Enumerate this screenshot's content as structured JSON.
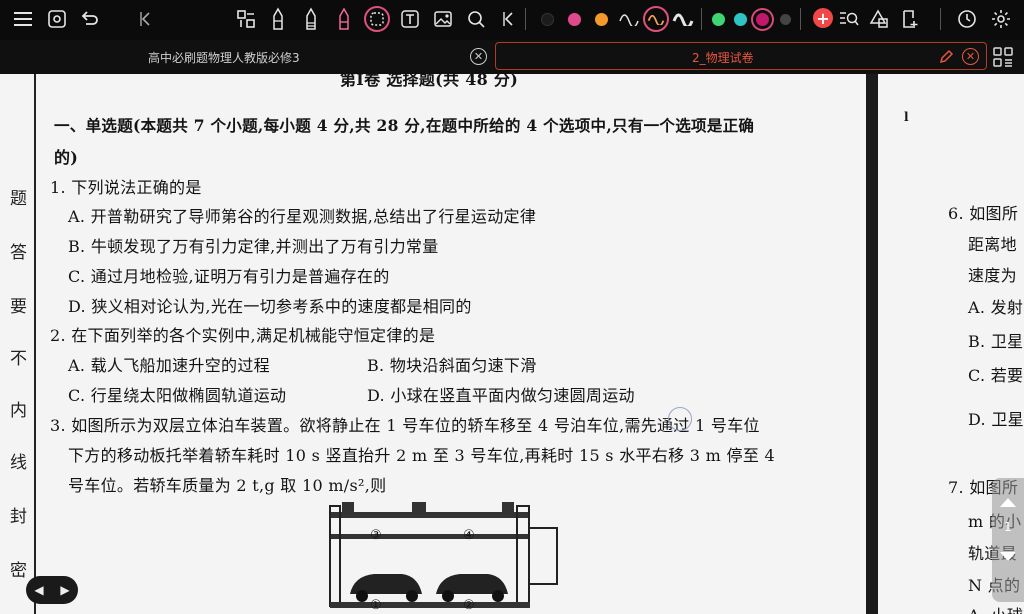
{
  "toolbar": {
    "icons": [
      "menu-icon",
      "settings-doc-icon",
      "undo-icon",
      "collapse-left-icon",
      "layout-icon",
      "pen-icon",
      "pencil-icon",
      "marker-icon",
      "lasso-icon",
      "text-icon",
      "image-icon",
      "shape-icon",
      "collapse-icon",
      "color-black",
      "color-pink",
      "color-orange",
      "wave-icon",
      "wave-selected-icon",
      "wave-bold-icon",
      "color-green",
      "color-teal",
      "color-magenta-selected",
      "color-gray",
      "add-color-icon",
      "zoom-icon",
      "shapes-icon",
      "add-page-icon",
      "clock-icon",
      "gear-icon"
    ],
    "colors": {
      "black": "#1c1c1c",
      "pink": "#e04a8c",
      "orange": "#f39a2a",
      "green": "#3dd672",
      "teal": "#2fc4c4",
      "magenta": "#c2186b",
      "gray": "#444444",
      "accent": "#e7553f"
    }
  },
  "tabs": [
    {
      "label": "高中必刷题物理人教版必修3",
      "active": false
    },
    {
      "label": "2_物理试卷",
      "active": true
    }
  ],
  "document": {
    "header_partial": "第Ⅰ卷  选择题(共 48 分)",
    "section1": "一、单选题(本题共 7 个小题,每小题 4 分,共 28 分,在题中所给的 4 个选项中,只有一个选项是正确",
    "section1_cont": "的)",
    "q1": "1. 下列说法正确的是",
    "q1a": "A. 开普勒研究了导师第谷的行星观测数据,总结出了行星运动定律",
    "q1b": "B. 牛顿发现了万有引力定律,并测出了万有引力常量",
    "q1c": "C. 通过月地检验,证明万有引力是普遍存在的",
    "q1d": "D. 狭义相对论认为,光在一切参考系中的速度都是相同的",
    "q2": "2. 在下面列举的各个实例中,满足机械能守恒定律的是",
    "q2a": "A. 载人飞船加速升空的过程",
    "q2b": "B. 物块沿斜面匀速下滑",
    "q2c": "C. 行星绕太阳做椭圆轨道运动",
    "q2d": "D. 小球在竖直平面内做匀速圆周运动",
    "q3_l1": "3. 如图所示为双层立体泊车装置。欲将静止在 1 号车位的轿车移至 4 号泊车位,需先通过 1 号车位",
    "q3_l2": "下方的移动板托举着轿车耗时 10 s 竖直抬升 2 m 至 3 号车位,再耗时 15 s 水平右移 3 m 停至 4",
    "q3_l3": "号车位。若轿车质量为 2 t,g 取 10 m/s²,则",
    "figure_labels": [
      "③",
      "④",
      "①",
      "②"
    ],
    "binding_chars": [
      "题",
      "答",
      "要",
      "不",
      "内",
      "线",
      "封",
      "密"
    ],
    "right_page": {
      "mark": "l",
      "q6_l1": "6. 如图所",
      "q6_l2": "距离地",
      "q6_l3": "速度为",
      "q6a": "A. 发射",
      "q6b": "B. 卫星",
      "q6c": "C. 若要",
      "q6d": "D. 卫星",
      "q7_l1": "7. 如图所",
      "q7_l2": "m 的小",
      "q7_l3": "轨道最",
      "q7_l4": "N 点的",
      "q7_l5": "A. 小球"
    }
  },
  "page_indicator": "1"
}
